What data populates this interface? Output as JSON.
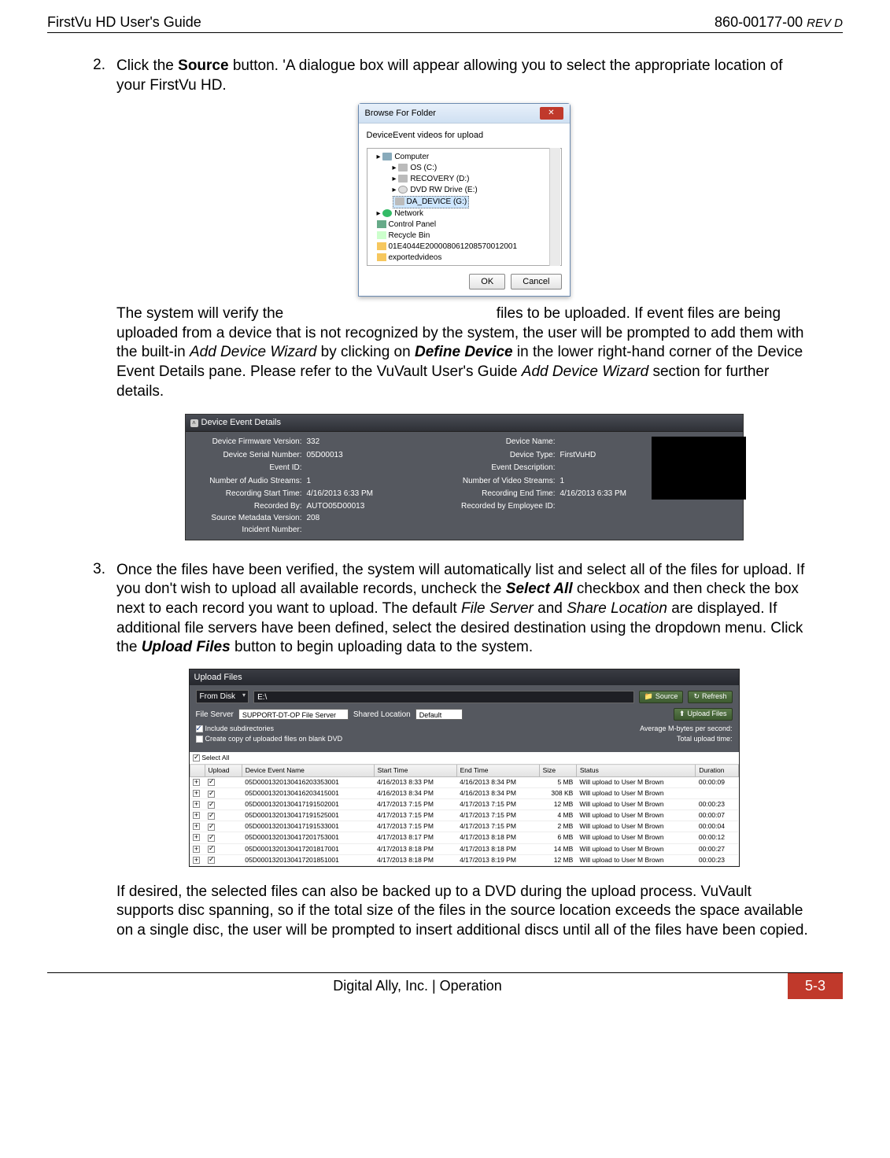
{
  "header": {
    "left": "FirstVu HD User's Guide",
    "right_doc": "860-00177-00 ",
    "right_rev": "REV D"
  },
  "step2": {
    "num": "2.",
    "text_a": "Click the ",
    "source": "Source",
    "text_b": " button. 'A dialogue box will appear allowing you to select the appropriate location of your FirstVu HD."
  },
  "browse": {
    "title": "Browse For Folder",
    "msg": "DeviceEvent videos for upload",
    "items": {
      "computer": "Computer",
      "os": "OS (C:)",
      "recovery": "RECOVERY (D:)",
      "dvd": "DVD RW Drive (E:)",
      "da": "DA_DEVICE (G:)",
      "network": "Network",
      "control": "Control Panel",
      "recycle": "Recycle Bin",
      "long": "01E4044E200008061208570012001",
      "cut": "exportedvideos"
    },
    "ok": "OK",
    "cancel": "Cancel"
  },
  "para_after_browse": {
    "a": "The system will verify the",
    "b": "files to be uploaded. If event files are being uploaded from a device that is not recognized by the system, the user will be prompted to add them with the built-in ",
    "add_wizard": "Add Device Wizard",
    "c": " by clicking on ",
    "define": "Define Device",
    "d": " in the lower right-hand corner of the Device Event Details pane. Please refer to the VuVault User's Guide ",
    "add_wizard2": "Add Device Wizard",
    "e": " section for further details."
  },
  "dev": {
    "header": "Device Event Details",
    "labels": {
      "fw": "Device Firmware Version:",
      "sn": "Device Serial Number:",
      "eid": "Event ID:",
      "aud": "Number of Audio Streams:",
      "rst": "Recording Start Time:",
      "rby": "Recorded By:",
      "smv": "Source Metadata Version:",
      "inc": "Incident Number:",
      "dname": "Device Name:",
      "dtype": "Device Type:",
      "edesc": "Event Description:",
      "vid": "Number of Video Streams:",
      "ret": "Recording End Time:",
      "remp": "Recorded by Employee ID:"
    },
    "vals": {
      "fw": "332",
      "sn": "05D00013",
      "eid": "",
      "aud": "1",
      "rst": "4/16/2013 6:33 PM",
      "rby": "AUTO05D00013",
      "smv": "208",
      "inc": "",
      "dname": "",
      "dtype": "FirstVuHD",
      "edesc": "",
      "vid": "1",
      "ret": "4/16/2013 6:33 PM",
      "remp": ""
    }
  },
  "step3": {
    "num": "3.",
    "a": "Once the files have been verified, the system will automatically list and select all of the files for upload. If you don't wish to upload all available records, uncheck the ",
    "selectall": "Select All",
    "b": " checkbox and then check the box next to each record you want to upload. The default ",
    "fileserver": "File Server",
    "c": " and ",
    "shareloc": "Share Location",
    "d": " are displayed. If additional file servers have been defined, select the desired destination using the dropdown menu. Click the ",
    "uploadfiles": "Upload Files",
    "e": " button to begin uploading data to the system."
  },
  "upload": {
    "title": "Upload Files",
    "from_disk": "From Disk",
    "path": "E:\\",
    "source_btn": "Source",
    "refresh_btn": "Refresh",
    "file_server_lbl": "File Server",
    "file_server_val": "SUPPORT-DT-OP File Server",
    "shared_lbl": "Shared Location",
    "shared_val": "Default",
    "upload_btn": "Upload Files",
    "chk_subdir": "Include subdirectories",
    "chk_dvd": "Create copy of uploaded files on blank DVD",
    "avg_lbl": "Average M-bytes per second:",
    "total_lbl": "Total upload time:",
    "select_all": "Select All",
    "cols": {
      "upload": "Upload",
      "name": "Device Event Name",
      "start": "Start Time",
      "end": "End Time",
      "size": "Size",
      "status": "Status",
      "dur": "Duration"
    },
    "rows": [
      {
        "name": "05D0001320130416203353001",
        "start": "4/16/2013 8:33 PM",
        "end": "4/16/2013 8:34 PM",
        "size": "5 MB",
        "status": "Will upload to User M Brown",
        "dur": "00:00:09"
      },
      {
        "name": "05D0001320130416203415001",
        "start": "4/16/2013 8:34 PM",
        "end": "4/16/2013 8:34 PM",
        "size": "308 KB",
        "status": "Will upload to User M Brown",
        "dur": ""
      },
      {
        "name": "05D0001320130417191502001",
        "start": "4/17/2013 7:15 PM",
        "end": "4/17/2013 7:15 PM",
        "size": "12 MB",
        "status": "Will upload to User M Brown",
        "dur": "00:00:23"
      },
      {
        "name": "05D0001320130417191525001",
        "start": "4/17/2013 7:15 PM",
        "end": "4/17/2013 7:15 PM",
        "size": "4 MB",
        "status": "Will upload to User M Brown",
        "dur": "00:00:07"
      },
      {
        "name": "05D0001320130417191533001",
        "start": "4/17/2013 7:15 PM",
        "end": "4/17/2013 7:15 PM",
        "size": "2 MB",
        "status": "Will upload to User M Brown",
        "dur": "00:00:04"
      },
      {
        "name": "05D0001320130417201753001",
        "start": "4/17/2013 8:17 PM",
        "end": "4/17/2013 8:18 PM",
        "size": "6 MB",
        "status": "Will upload to User M Brown",
        "dur": "00:00:12"
      },
      {
        "name": "05D0001320130417201817001",
        "start": "4/17/2013 8:18 PM",
        "end": "4/17/2013 8:18 PM",
        "size": "14 MB",
        "status": "Will upload to User M Brown",
        "dur": "00:00:27"
      },
      {
        "name": "05D0001320130417201851001",
        "start": "4/17/2013 8:18 PM",
        "end": "4/17/2013 8:19 PM",
        "size": "12 MB",
        "status": "Will upload to User M Brown",
        "dur": "00:00:23"
      }
    ]
  },
  "para_after_upload": "If desired, the selected files can also be backed up to a DVD during the upload process. VuVault supports disc spanning, so if the total size of the files in the source location exceeds the space available on a single disc, the user will be prompted to insert additional discs until all of the files have been copied.",
  "footer": {
    "center": "Digital Ally, Inc. | Operation",
    "page": "5-3"
  }
}
